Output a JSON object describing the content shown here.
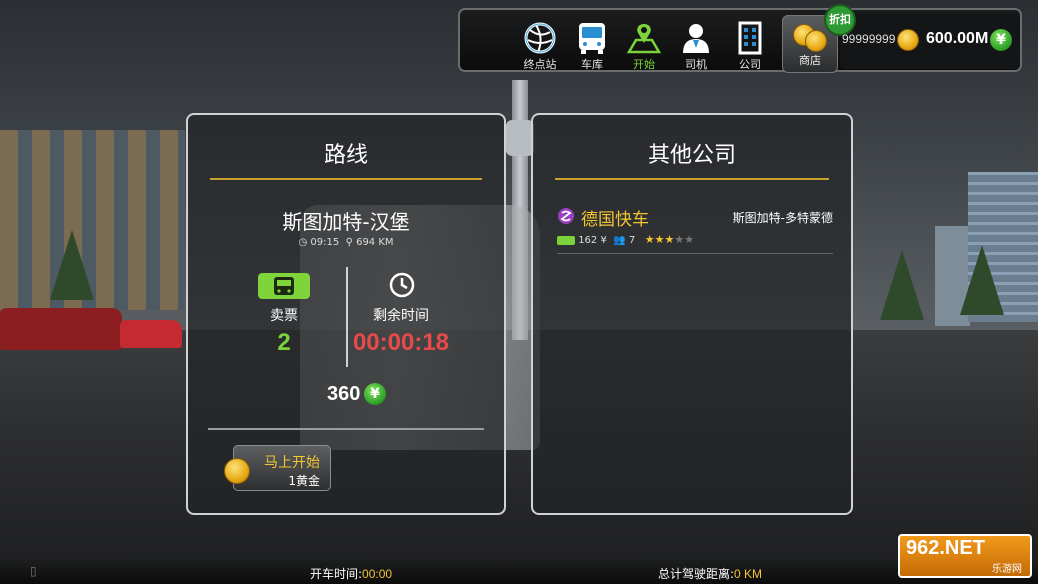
{
  "nav": {
    "items": [
      {
        "id": "terminal",
        "label": "终点站"
      },
      {
        "id": "garage",
        "label": "车库"
      },
      {
        "id": "start",
        "label": "开始"
      },
      {
        "id": "driver",
        "label": "司机"
      },
      {
        "id": "company",
        "label": "公司"
      }
    ],
    "shop_label": "商店",
    "discount_badge": "折扣",
    "gold_amount": "99999999",
    "money_amount": "600.00M",
    "money_symbol": "¥",
    "active_item": "start"
  },
  "route_panel": {
    "title": "路线",
    "route_name": "斯图加特-汉堡",
    "departure_time": "09:15",
    "distance": "694 KM",
    "tickets_label": "卖票",
    "tickets_value": "2",
    "time_left_label": "剩余时间",
    "time_left_value": "00:00:18",
    "fare_value": "360",
    "fare_symbol": "¥",
    "start_now_label": "马上开始",
    "start_now_cost": "1黄金"
  },
  "companies_panel": {
    "title": "其他公司",
    "companies": [
      {
        "name": "德国快车",
        "route": "斯图加特-多特蒙德",
        "price": "162 ¥",
        "drivers": "7",
        "rating": 3,
        "rating_max": 5
      }
    ]
  },
  "bottom_bar": {
    "drive_time_label": "开车时间:",
    "drive_time_value": "00:00",
    "total_distance_label": "总计驾驶距离:",
    "total_distance_value": "0 KM"
  },
  "watermark": {
    "top": "962.NET",
    "bottom": "乐游网"
  },
  "colors": {
    "accent_gold": "#f3c531",
    "accent_green": "#7bd23a",
    "timer_red": "#e84a4a",
    "panel_border": "#cfd2d4"
  }
}
